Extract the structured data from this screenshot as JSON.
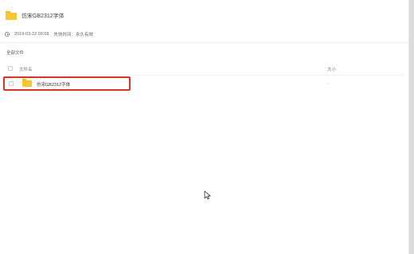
{
  "header": {
    "title": "仿宋GB2312字体"
  },
  "meta": {
    "datetime": "2019-03-22 09:58",
    "expiry": "失效时间：永久有效"
  },
  "section": {
    "all_files": "全部文件"
  },
  "table": {
    "columns": {
      "name": "文件名",
      "size": "大小"
    },
    "rows": [
      {
        "name": "仿宋GB2312字体",
        "size": "-"
      }
    ]
  },
  "colors": {
    "folder": "#fbc531",
    "highlight": "#d9342b"
  },
  "icons": [
    "folder-icon",
    "clock-icon",
    "mouse-cursor-icon"
  ]
}
